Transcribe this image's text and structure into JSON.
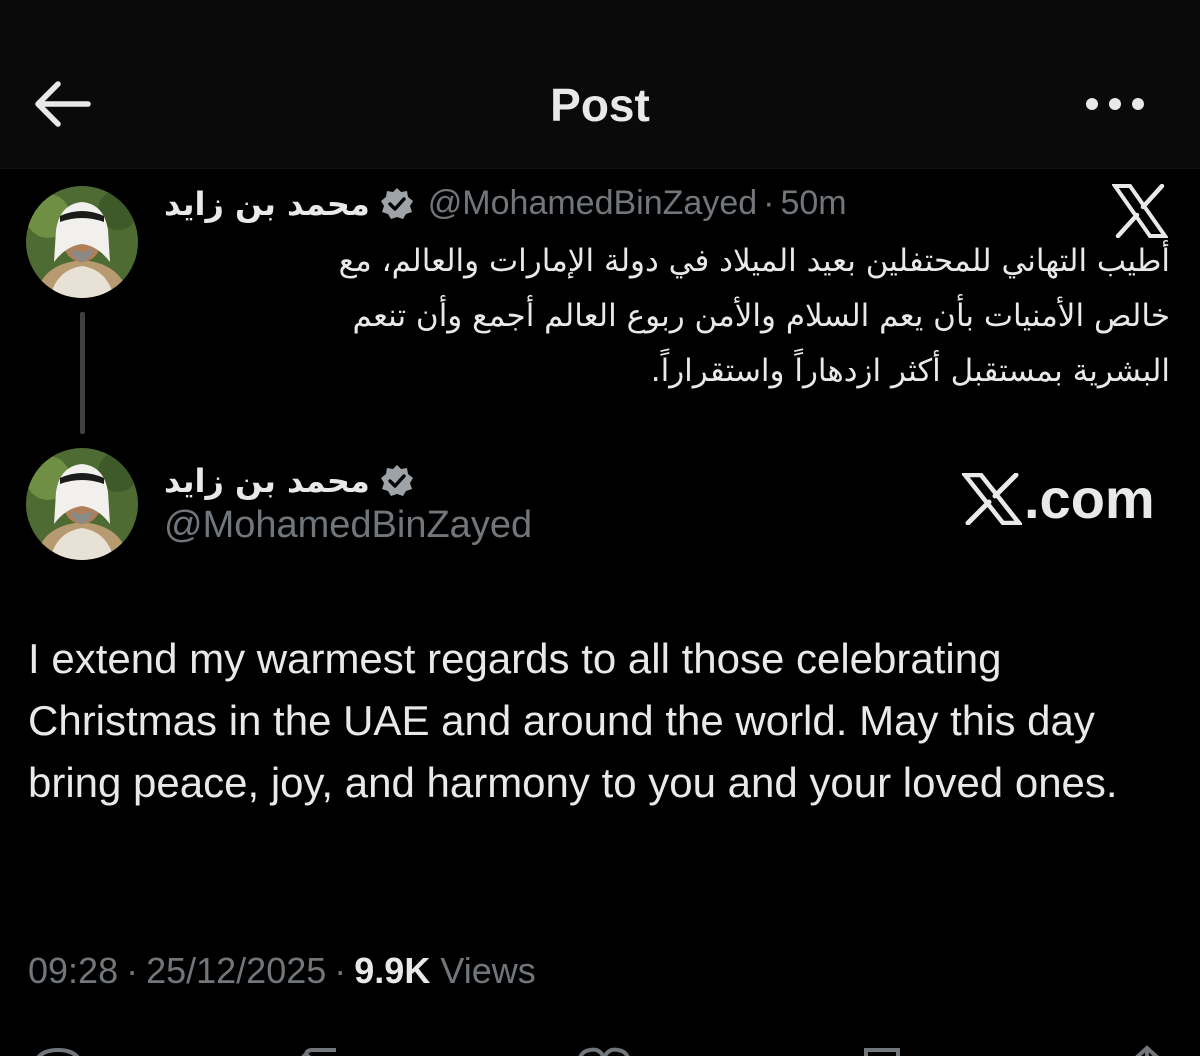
{
  "header": {
    "title": "Post",
    "back_icon": "arrow-left-icon",
    "more_icon": "more-horizontal-icon"
  },
  "quoted_post": {
    "display_name": "محمد بن زايد",
    "handle": "@MohamedBinZayed",
    "separator": "·",
    "time_ago": "50m",
    "text": "أطيب التهاني للمحتفلين بعيد الميلاد في دولة الإمارات والعالم، مع\nخالص الأمنيات بأن يعم السلام والأمن ربوع العالم أجمع وأن تنعم\nالبشرية بمستقبل أكثر ازدهاراً واستقراراً."
  },
  "main_post": {
    "display_name": "محمد بن زايد",
    "handle": "@MohamedBinZayed",
    "watermark": ".com",
    "text": "I extend my warmest regards to all those celebrating Christmas in the UAE and around the world. May this day bring peace, joy, and harmony to you and your loved ones.",
    "time": "09:28",
    "date": "25/12/2025",
    "separator": "·",
    "views_count": "9.9K",
    "views_label": "Views"
  },
  "colors": {
    "background": "#000000",
    "text_primary": "#e7e9ea",
    "text_secondary": "#71767b",
    "verified_badge": "#9ea3a8",
    "thread_line": "#3e4144"
  }
}
